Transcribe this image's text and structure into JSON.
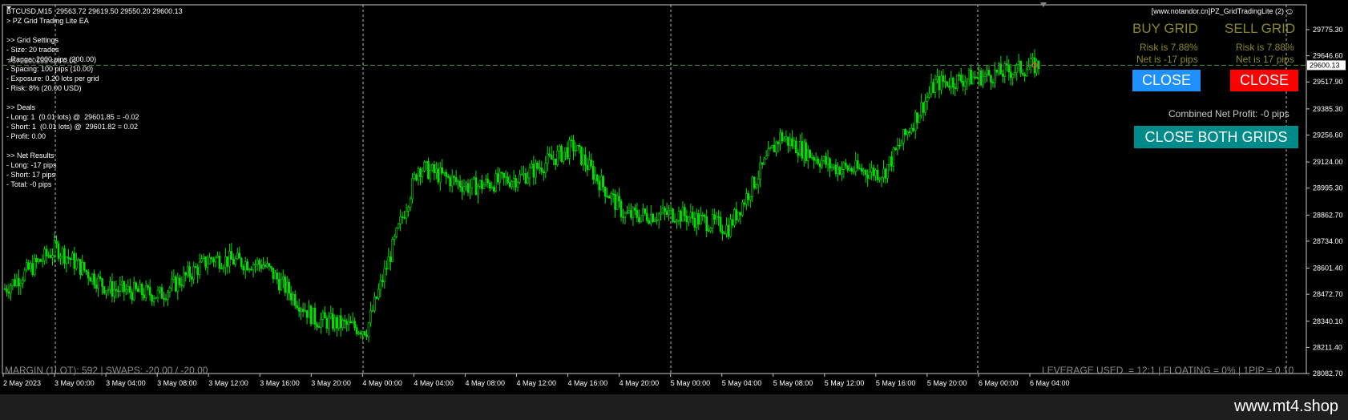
{
  "symbol_header": "BTCUSD,M15  29563.72 29619.50 29550.20 29600.13",
  "ea_name": "> PZ Grid Trading Lite EA",
  "info_lines": [
    "",
    ">> Grid Settings",
    "- Size: 20 trades",
    "- Range: 2000 pips (200.00)",
    "- Spacing: 100 pips (10.00)",
    "- Exposure: 0.20 lots per grid",
    "- Risk: 8% (20.00 USD)",
    "",
    ">> Deals",
    "- Long: 1  (0.01 lots) @  29601.85 = -0.02",
    "- Short: 1  (0.01 lots) @  29601.82 = 0.02",
    "- Profit: 0.00",
    "",
    ">> Net Results",
    "- Long: -17 pips",
    "- Short: 17 pips",
    "- Total: -0 pips"
  ],
  "order_label": "#672600153 sell 0.01",
  "top_right_caption": "[www.notandor.cn]PZ_GridTradingLite (2)",
  "buy_grid": {
    "title": "BUY GRID",
    "risk": "Risk is 7.88%",
    "net": "Net is -17 pips",
    "close_label": "CLOSE"
  },
  "sell_grid": {
    "title": "SELL GRID",
    "risk": "Risk is 7.88%",
    "net": "Net is 17 pips",
    "close_label": "CLOSE"
  },
  "combined_profit": "Combined Net Profit: -0 pips",
  "close_both_label": "CLOSE BOTH GRIDS",
  "margin_text": "MARGIN (1LOT): 592 | SWAPS: -20.00 / -20.00",
  "leverage_text": "LEVERAGE USED  = 12:1 | FLOATING = 0% | 1PIP = 0.10",
  "price_axis": [
    "29775.30",
    "29646.60",
    "29517.90",
    "29385.30",
    "29256.60",
    "29124.00",
    "28995.30",
    "28862.70",
    "28734.00",
    "28601.40",
    "28472.70",
    "28340.10",
    "28211.40",
    "28082.70"
  ],
  "current_price": "29600.13",
  "time_axis": [
    "2 May 2023",
    "3 May 00:00",
    "3 May 04:00",
    "3 May 08:00",
    "3 May 12:00",
    "3 May 16:00",
    "3 May 20:00",
    "4 May 00:00",
    "4 May 04:00",
    "4 May 08:00",
    "4 May 12:00",
    "4 May 16:00",
    "4 May 20:00",
    "5 May 00:00",
    "5 May 04:00",
    "5 May 08:00",
    "5 May 12:00",
    "5 May 16:00",
    "5 May 20:00",
    "6 May 00:00",
    "6 May 04:00"
  ],
  "watermark": "www.mt4.shop",
  "colors": {
    "candle": "#00e000",
    "buy_button": "#1e90ff",
    "sell_button": "#ff0000",
    "close_both": "#008b8b",
    "panel_text": "#8a8a1f"
  },
  "chart_data": {
    "type": "candlestick",
    "ylim": [
      28082.7,
      29775.3
    ],
    "x": [
      "2 May 2023",
      "3 May 00:00",
      "3 May 04:00",
      "3 May 08:00",
      "3 May 12:00",
      "3 May 16:00",
      "3 May 20:00",
      "4 May 00:00",
      "4 May 04:00",
      "4 May 08:00",
      "4 May 12:00",
      "4 May 16:00",
      "4 May 20:00",
      "5 May 00:00",
      "5 May 04:00",
      "5 May 08:00",
      "5 May 12:00",
      "5 May 16:00",
      "5 May 20:00",
      "6 May 00:00",
      "6 May 04:00"
    ],
    "close": [
      28500,
      28700,
      28500,
      28470,
      28650,
      28620,
      28350,
      28300,
      29100,
      29000,
      29050,
      29200,
      28860,
      28870,
      28800,
      29250,
      29100,
      29070,
      29510,
      29550,
      29600
    ]
  }
}
